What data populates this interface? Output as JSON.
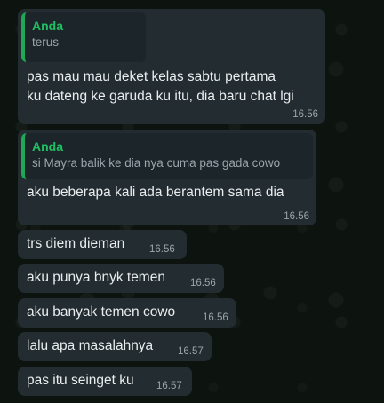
{
  "messages": [
    {
      "reply_author": "Anda",
      "reply_text": "terus",
      "line1": "pas mau mau deket kelas sabtu pertama",
      "line2": "ku dateng ke garuda ku itu, dia baru chat lgi",
      "time": "16.56"
    },
    {
      "reply_author": "Anda",
      "reply_text": "si Mayra balik ke dia nya cuma pas gada cowo",
      "text": "aku beberapa kali ada berantem sama dia",
      "time": "16.56"
    },
    {
      "text": "trs diem dieman",
      "time": "16.56"
    },
    {
      "text": "aku punya bnyk temen",
      "time": "16.56"
    },
    {
      "text": "aku banyak temen cowo",
      "time": "16.56"
    },
    {
      "text": "lalu apa masalahnya",
      "time": "16.57"
    },
    {
      "text": "pas itu seinget ku",
      "time": "16.57"
    }
  ]
}
